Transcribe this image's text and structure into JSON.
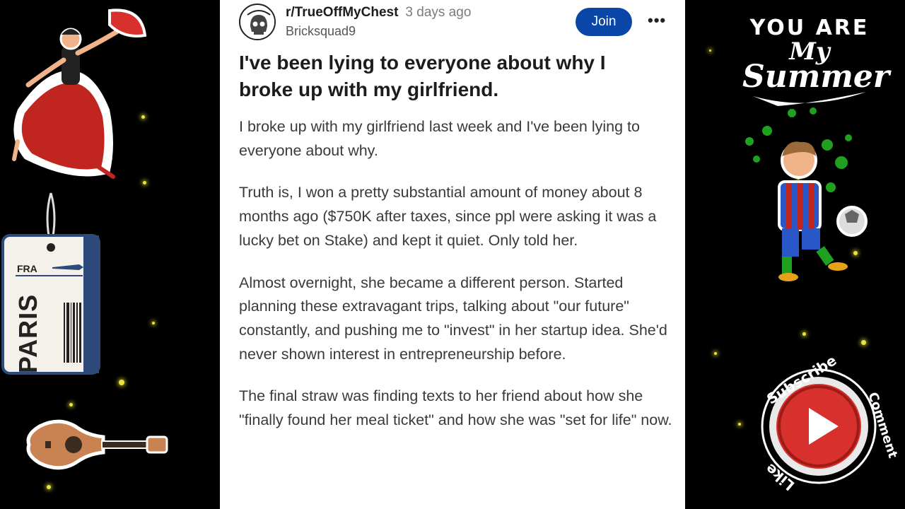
{
  "post": {
    "subreddit": "r/TrueOffMyChest",
    "time": "3 days ago",
    "author": "Bricksquad9",
    "join_label": "Join",
    "more_label": "•••",
    "title": "I've been lying to everyone about why I broke up with my girlfriend.",
    "paragraphs": [
      "I broke up with my girlfriend last week and I've been lying to everyone about why.",
      "Truth is, I won a pretty substantial amount of money about 8 months ago ($750K after taxes, since ppl were asking it was a lucky bet on Stake) and kept it quiet. Only told her.",
      "Almost overnight, she became a different person. Started planning these extravagant trips, talking about \"our future\" constantly, and pushing me to \"invest\" in her startup idea. She'd never shown interest in entrepreneurship before.",
      "The final straw was finding texts to her friend about how she \"finally found her meal ticket\" and how she was \"set for life\" now."
    ]
  },
  "stickers": {
    "tag_code": "FRA",
    "tag_city": "PARIS",
    "you_are_line1": "YOU ARE",
    "you_are_line2": "My",
    "you_are_line3": "Summer",
    "subscribe": "Subscribe",
    "comment": "Comment",
    "like": "Like"
  },
  "colors": {
    "join_bg": "#0a45a8",
    "sparkle": "#e8e33a",
    "play_red": "#d8302c"
  }
}
